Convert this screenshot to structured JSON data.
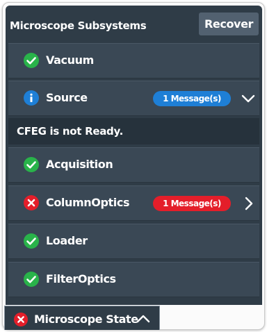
{
  "header": {
    "title": "Microscope Subsystems",
    "recover_label": "Recover"
  },
  "subsystems": [
    {
      "label": "Vacuum",
      "status": "ok",
      "icon": "check-circle-icon"
    },
    {
      "label": "Source",
      "status": "info",
      "icon": "info-circle-icon",
      "badge": "1 Message(s)",
      "expander": "chevron-down-icon"
    },
    {
      "label": "Acquisition",
      "status": "ok",
      "icon": "check-circle-icon"
    },
    {
      "label": "ColumnOptics",
      "status": "error",
      "icon": "x-circle-icon",
      "badge": "1 Message(s)",
      "expander": "chevron-right-icon"
    },
    {
      "label": "Loader",
      "status": "ok",
      "icon": "check-circle-icon"
    },
    {
      "label": "FilterOptics",
      "status": "ok",
      "icon": "check-circle-icon"
    }
  ],
  "source_message": "CFEG is not Ready.",
  "footer": {
    "label": "Microscope State",
    "status": "error",
    "icon": "x-circle-icon",
    "expander": "chevron-up-icon"
  },
  "colors": {
    "panel_bg": "#2f3c47",
    "row_bg": "#3a4855",
    "ok_green": "#29b34a",
    "info_blue": "#1e7fd6",
    "error_red": "#e41e2a"
  }
}
